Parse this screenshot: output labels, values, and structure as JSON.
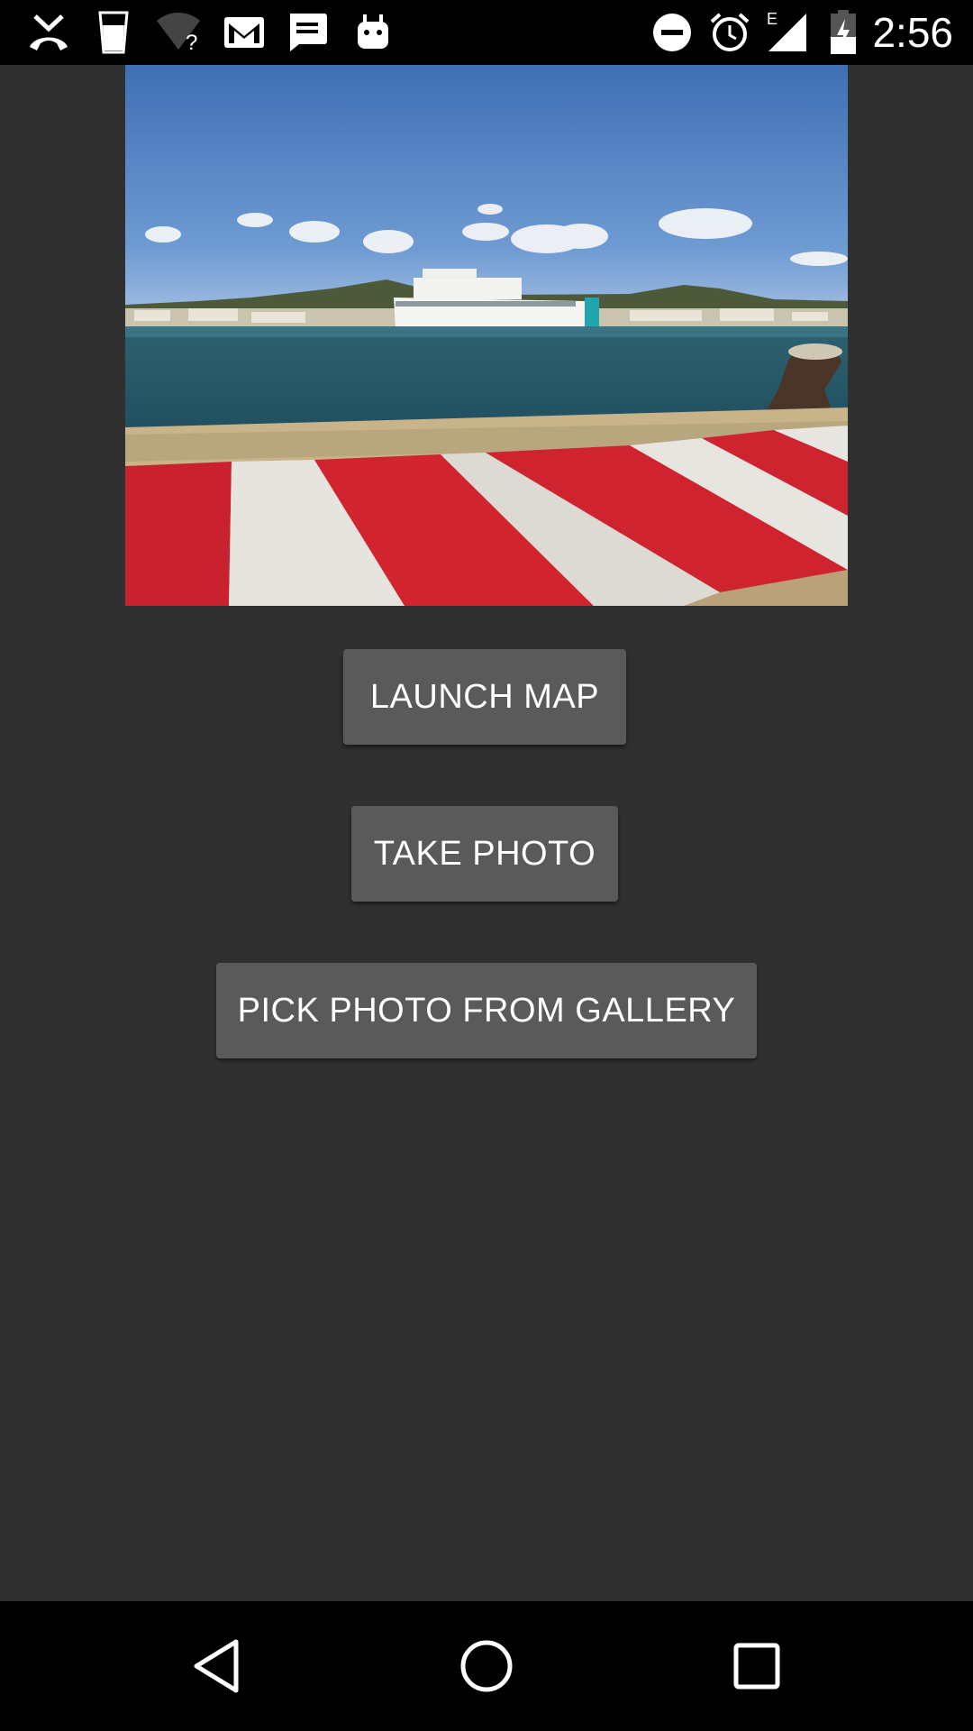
{
  "status_bar": {
    "time": "2:56",
    "network_type": "E",
    "left_icons": [
      "missed-call-icon",
      "cup-icon",
      "wifi-unknown-icon",
      "gmail-icon",
      "message-icon",
      "android-icon"
    ],
    "right_icons": [
      "do-not-disturb-icon",
      "alarm-icon",
      "signal-icon",
      "battery-charging-icon"
    ]
  },
  "main": {
    "image": {
      "description_icon": "harbor-photo"
    },
    "buttons": {
      "launch_map": "LAUNCH MAP",
      "take_photo": "TAKE PHOTO",
      "pick_photo": "PICK PHOTO FROM GALLERY"
    }
  },
  "nav_bar": {
    "icons": [
      "back-icon",
      "home-icon",
      "recents-icon"
    ]
  },
  "colors": {
    "background": "#303030",
    "button": "#5a5a5b",
    "bars": "#000000"
  }
}
